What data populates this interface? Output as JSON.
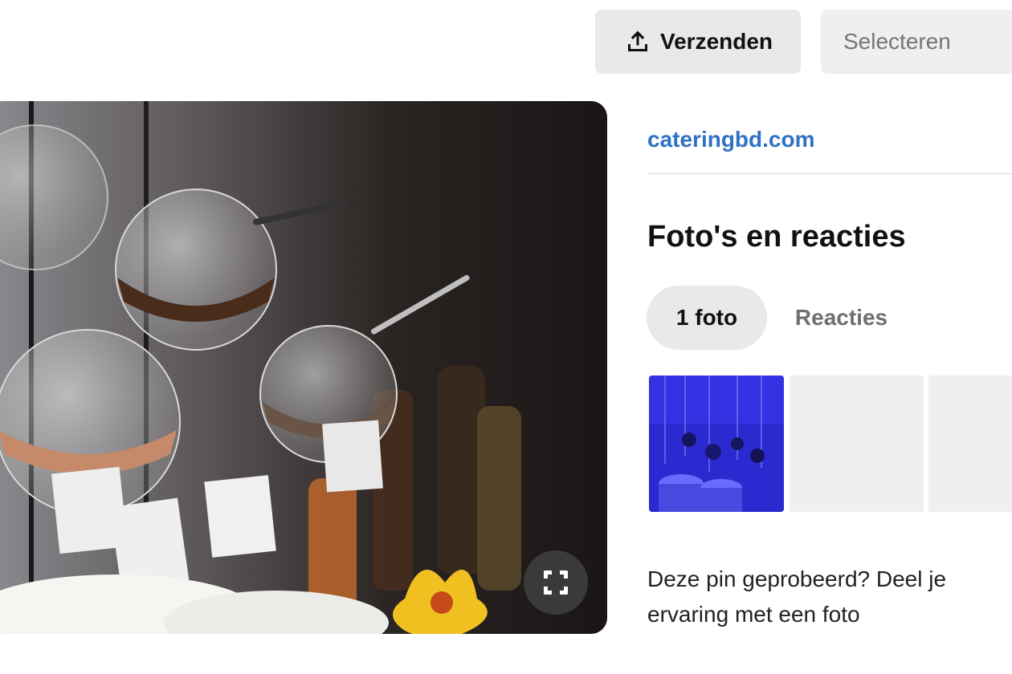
{
  "header": {
    "share_button_label": "Verzenden",
    "select_placeholder": "Selecteren"
  },
  "pin": {
    "image_description_icon": "photo",
    "expand_icon": "expand-icon"
  },
  "details": {
    "source_link": "cateringbd.com",
    "section_title": "Foto's en reacties",
    "tabs": [
      {
        "label": "1 foto",
        "active": true
      },
      {
        "label": "Reacties",
        "active": false
      }
    ],
    "prompt_text": "Deze pin geprobeerd? Deel je ervaring met een foto"
  },
  "colors": {
    "link": "#2f72c4",
    "button_bg": "#e9e9e9",
    "muted_text": "#6f6f6f"
  }
}
